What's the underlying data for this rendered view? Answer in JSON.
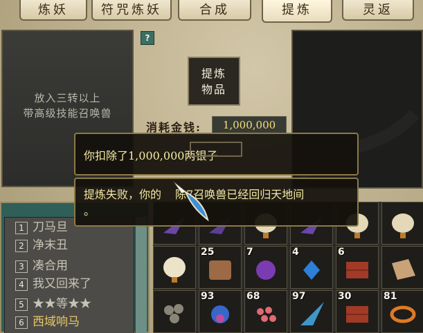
{
  "tabs": [
    {
      "label": "炼妖",
      "active": false
    },
    {
      "label": "符咒炼妖",
      "active": false
    },
    {
      "label": "合成",
      "active": false
    },
    {
      "label": "提炼",
      "active": true
    },
    {
      "label": "灵返",
      "active": false
    }
  ],
  "drop_hint": [
    "放入三转以上",
    "带高级技能召唤兽"
  ],
  "help_label": "?",
  "refine_button": [
    "提炼",
    "物品"
  ],
  "cost": {
    "label": "消耗金钱:",
    "value": "1,000,000"
  },
  "messages": [
    "你扣除了1,000,000两银子",
    "提炼失败，你的",
    "陈7召唤兽已经回归天地间",
    "。"
  ],
  "pets": [
    {
      "num": "1",
      "name": "刀马旦",
      "highlight": false
    },
    {
      "num": "2",
      "name": "净末丑",
      "highlight": false
    },
    {
      "num": "3",
      "name": "凑合用",
      "highlight": false
    },
    {
      "num": "4",
      "name": "我又回来了",
      "highlight": false
    },
    {
      "num": "5",
      "name": "★★等★★",
      "highlight": false
    },
    {
      "num": "6",
      "name": "西域响马",
      "highlight": true
    }
  ],
  "inventory_quantities": [
    "25",
    "7",
    "4",
    "6",
    "93",
    "68",
    "97",
    "30",
    "81"
  ],
  "colors": {
    "tip_text": "#f3e9a3",
    "cost_value": "#f4e07a",
    "pet_highlight": "#e7c766"
  }
}
